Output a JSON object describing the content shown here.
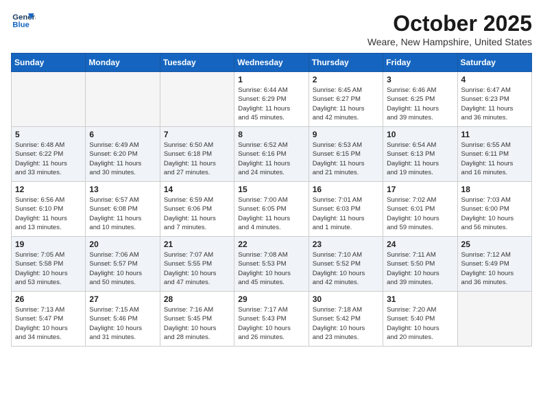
{
  "header": {
    "logo_line1": "General",
    "logo_line2": "Blue",
    "month": "October 2025",
    "location": "Weare, New Hampshire, United States"
  },
  "weekdays": [
    "Sunday",
    "Monday",
    "Tuesday",
    "Wednesday",
    "Thursday",
    "Friday",
    "Saturday"
  ],
  "weeks": [
    [
      {
        "day": "",
        "info": ""
      },
      {
        "day": "",
        "info": ""
      },
      {
        "day": "",
        "info": ""
      },
      {
        "day": "1",
        "info": "Sunrise: 6:44 AM\nSunset: 6:29 PM\nDaylight: 11 hours\nand 45 minutes."
      },
      {
        "day": "2",
        "info": "Sunrise: 6:45 AM\nSunset: 6:27 PM\nDaylight: 11 hours\nand 42 minutes."
      },
      {
        "day": "3",
        "info": "Sunrise: 6:46 AM\nSunset: 6:25 PM\nDaylight: 11 hours\nand 39 minutes."
      },
      {
        "day": "4",
        "info": "Sunrise: 6:47 AM\nSunset: 6:23 PM\nDaylight: 11 hours\nand 36 minutes."
      }
    ],
    [
      {
        "day": "5",
        "info": "Sunrise: 6:48 AM\nSunset: 6:22 PM\nDaylight: 11 hours\nand 33 minutes."
      },
      {
        "day": "6",
        "info": "Sunrise: 6:49 AM\nSunset: 6:20 PM\nDaylight: 11 hours\nand 30 minutes."
      },
      {
        "day": "7",
        "info": "Sunrise: 6:50 AM\nSunset: 6:18 PM\nDaylight: 11 hours\nand 27 minutes."
      },
      {
        "day": "8",
        "info": "Sunrise: 6:52 AM\nSunset: 6:16 PM\nDaylight: 11 hours\nand 24 minutes."
      },
      {
        "day": "9",
        "info": "Sunrise: 6:53 AM\nSunset: 6:15 PM\nDaylight: 11 hours\nand 21 minutes."
      },
      {
        "day": "10",
        "info": "Sunrise: 6:54 AM\nSunset: 6:13 PM\nDaylight: 11 hours\nand 19 minutes."
      },
      {
        "day": "11",
        "info": "Sunrise: 6:55 AM\nSunset: 6:11 PM\nDaylight: 11 hours\nand 16 minutes."
      }
    ],
    [
      {
        "day": "12",
        "info": "Sunrise: 6:56 AM\nSunset: 6:10 PM\nDaylight: 11 hours\nand 13 minutes."
      },
      {
        "day": "13",
        "info": "Sunrise: 6:57 AM\nSunset: 6:08 PM\nDaylight: 11 hours\nand 10 minutes."
      },
      {
        "day": "14",
        "info": "Sunrise: 6:59 AM\nSunset: 6:06 PM\nDaylight: 11 hours\nand 7 minutes."
      },
      {
        "day": "15",
        "info": "Sunrise: 7:00 AM\nSunset: 6:05 PM\nDaylight: 11 hours\nand 4 minutes."
      },
      {
        "day": "16",
        "info": "Sunrise: 7:01 AM\nSunset: 6:03 PM\nDaylight: 11 hours\nand 1 minute."
      },
      {
        "day": "17",
        "info": "Sunrise: 7:02 AM\nSunset: 6:01 PM\nDaylight: 10 hours\nand 59 minutes."
      },
      {
        "day": "18",
        "info": "Sunrise: 7:03 AM\nSunset: 6:00 PM\nDaylight: 10 hours\nand 56 minutes."
      }
    ],
    [
      {
        "day": "19",
        "info": "Sunrise: 7:05 AM\nSunset: 5:58 PM\nDaylight: 10 hours\nand 53 minutes."
      },
      {
        "day": "20",
        "info": "Sunrise: 7:06 AM\nSunset: 5:57 PM\nDaylight: 10 hours\nand 50 minutes."
      },
      {
        "day": "21",
        "info": "Sunrise: 7:07 AM\nSunset: 5:55 PM\nDaylight: 10 hours\nand 47 minutes."
      },
      {
        "day": "22",
        "info": "Sunrise: 7:08 AM\nSunset: 5:53 PM\nDaylight: 10 hours\nand 45 minutes."
      },
      {
        "day": "23",
        "info": "Sunrise: 7:10 AM\nSunset: 5:52 PM\nDaylight: 10 hours\nand 42 minutes."
      },
      {
        "day": "24",
        "info": "Sunrise: 7:11 AM\nSunset: 5:50 PM\nDaylight: 10 hours\nand 39 minutes."
      },
      {
        "day": "25",
        "info": "Sunrise: 7:12 AM\nSunset: 5:49 PM\nDaylight: 10 hours\nand 36 minutes."
      }
    ],
    [
      {
        "day": "26",
        "info": "Sunrise: 7:13 AM\nSunset: 5:47 PM\nDaylight: 10 hours\nand 34 minutes."
      },
      {
        "day": "27",
        "info": "Sunrise: 7:15 AM\nSunset: 5:46 PM\nDaylight: 10 hours\nand 31 minutes."
      },
      {
        "day": "28",
        "info": "Sunrise: 7:16 AM\nSunset: 5:45 PM\nDaylight: 10 hours\nand 28 minutes."
      },
      {
        "day": "29",
        "info": "Sunrise: 7:17 AM\nSunset: 5:43 PM\nDaylight: 10 hours\nand 26 minutes."
      },
      {
        "day": "30",
        "info": "Sunrise: 7:18 AM\nSunset: 5:42 PM\nDaylight: 10 hours\nand 23 minutes."
      },
      {
        "day": "31",
        "info": "Sunrise: 7:20 AM\nSunset: 5:40 PM\nDaylight: 10 hours\nand 20 minutes."
      },
      {
        "day": "",
        "info": ""
      }
    ]
  ]
}
